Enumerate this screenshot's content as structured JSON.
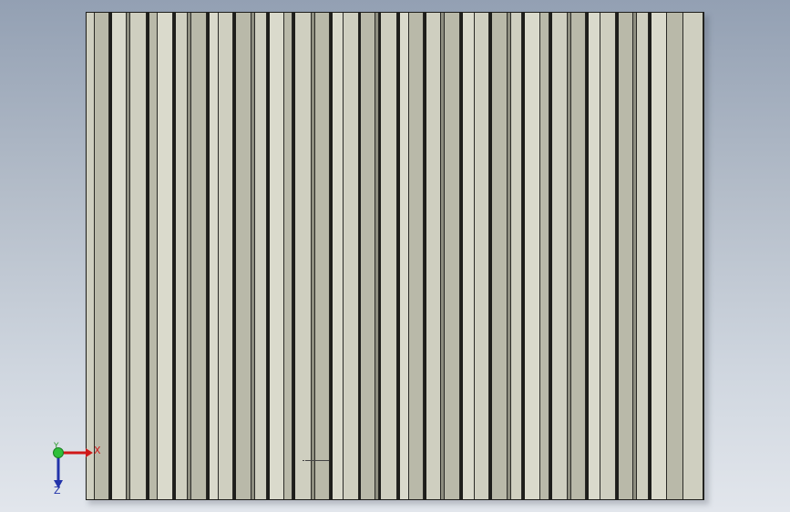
{
  "viewport": {
    "background_top": "#93a0b3",
    "background_bottom": "#e2e6ec"
  },
  "model": {
    "face_color": "#c9c8b8",
    "edge_color": "#1d1d1a"
  },
  "triad": {
    "x_label": "X",
    "y_label": "Y",
    "z_label": "Z",
    "x_color": "#d01818",
    "y_color": "#2a9a2a",
    "z_color": "#2233aa"
  }
}
